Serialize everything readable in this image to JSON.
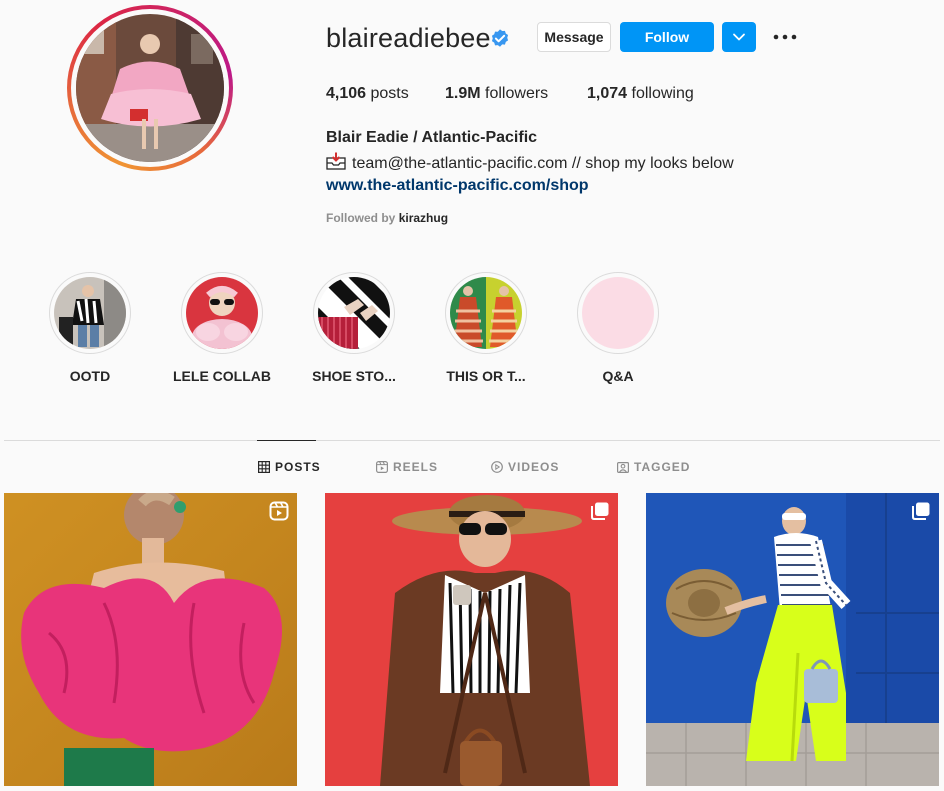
{
  "profile": {
    "username": "blaireadiebee",
    "verified": true,
    "message_label": "Message",
    "follow_label": "Follow",
    "stats": {
      "posts_count": "4,106",
      "posts_label": "posts",
      "followers_count": "1.9M",
      "followers_label": "followers",
      "following_count": "1,074",
      "following_label": "following"
    },
    "full_name": "Blair Eadie / Atlantic-Pacific",
    "bio": "team@the-atlantic-pacific.com // shop my looks below",
    "link": "www.the-atlantic-pacific.com/shop",
    "followed_by_label": "Followed by",
    "followed_by_user": "kirazhug"
  },
  "highlights": [
    {
      "label": "OOTD"
    },
    {
      "label": "LELE COLLAB"
    },
    {
      "label": "SHOE STO..."
    },
    {
      "label": "THIS OR T..."
    },
    {
      "label": "Q&A"
    }
  ],
  "tabs": [
    {
      "label": "POSTS",
      "icon": "grid-icon",
      "active": true
    },
    {
      "label": "REELS",
      "icon": "reels-icon",
      "active": false
    },
    {
      "label": "VIDEOS",
      "icon": "play-icon",
      "active": false
    },
    {
      "label": "TAGGED",
      "icon": "tag-icon",
      "active": false
    }
  ],
  "posts": [
    {
      "badge": "reels-icon"
    },
    {
      "badge": "carousel-icon"
    },
    {
      "badge": "carousel-icon"
    }
  ],
  "colors": {
    "accent": "#0095f6",
    "link": "#00376b",
    "muted": "#8e8e8e",
    "border": "#dbdbdb"
  }
}
